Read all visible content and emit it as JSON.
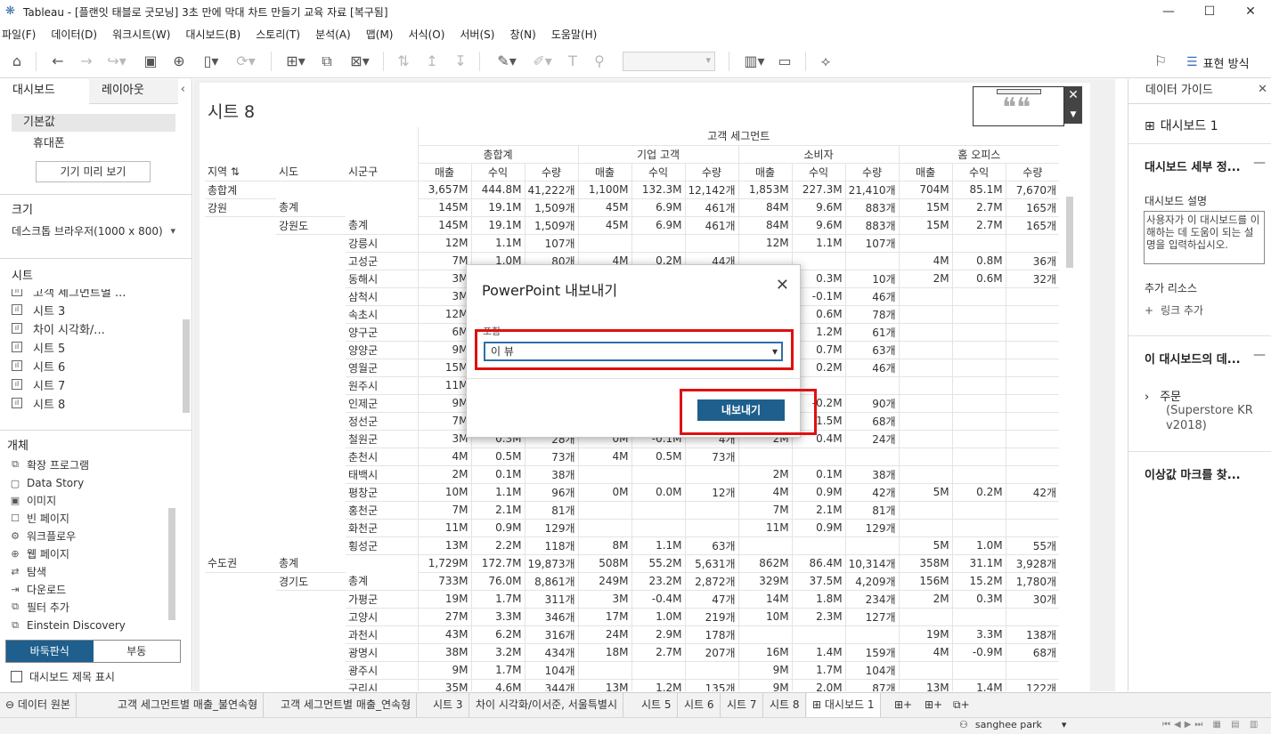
{
  "window": {
    "title": "Tableau - [플랜잇 태블로 굿모닝] 3초 만에 막대 차트 만들기 교육 자료 [복구됨]",
    "minimize": "—",
    "maximize": "☐",
    "close": "✕"
  },
  "menu": [
    "파일(F)",
    "데이터(D)",
    "워크시트(W)",
    "대시보드(B)",
    "스토리(T)",
    "분석(A)",
    "맵(M)",
    "서식(O)",
    "서버(S)",
    "창(N)",
    "도움말(H)"
  ],
  "toolbar": {
    "present_label": "표현 방식"
  },
  "left": {
    "tab_dashboard": "대시보드",
    "tab_layout": "레이아웃",
    "device_default": "기본값",
    "device_phone": "휴대폰",
    "preview_button": "기기 미리 보기",
    "size_header": "크기",
    "size_value": "데스크톱 브라우저(1000 x 800)",
    "sheets_header": "시트",
    "sheets": [
      "고객 세그먼트별 ...",
      "시트 3",
      "차이 시각화/...",
      "시트 5",
      "시트 6",
      "시트 7",
      "시트 8"
    ],
    "objects_header": "개체",
    "objects": [
      {
        "icon": "extension-icon",
        "glyph": "⧉",
        "label": "확장 프로그램"
      },
      {
        "icon": "data-story-icon",
        "glyph": "▢",
        "label": "Data Story"
      },
      {
        "icon": "image-icon",
        "glyph": "▣",
        "label": "이미지"
      },
      {
        "icon": "blank-page-icon",
        "glyph": "☐",
        "label": "빈 페이지"
      },
      {
        "icon": "workflow-icon",
        "glyph": "⚙",
        "label": "워크플로우"
      },
      {
        "icon": "web-page-icon",
        "glyph": "⊕",
        "label": "웹 페이지"
      },
      {
        "icon": "navigation-icon",
        "glyph": "⇄",
        "label": "탐색"
      },
      {
        "icon": "download-icon",
        "glyph": "⇥",
        "label": "다운로드"
      },
      {
        "icon": "filter-add-icon",
        "glyph": "⧉",
        "label": "필터 추가"
      },
      {
        "icon": "einstein-icon",
        "glyph": "⧉",
        "label": "Einstein Discovery"
      }
    ],
    "tiled": "바둑판식",
    "floating": "부동",
    "show_title": "대시보드 제목 표시"
  },
  "dashboard": {
    "sheet_title": "시트 8",
    "segment_header": "고객 세그먼트",
    "segments": [
      "총합계",
      "기업 고객",
      "소비자",
      "홈 오피스"
    ],
    "measures": [
      "매출",
      "수익",
      "수량"
    ],
    "dim_headers": [
      "지역",
      "시도",
      "시군구"
    ],
    "rows": [
      [
        "총합계",
        "",
        "",
        "3,657M",
        "444.8M",
        "41,222개",
        "1,100M",
        "132.3M",
        "12,142개",
        "1,853M",
        "227.3M",
        "21,410개",
        "704M",
        "85.1M",
        "7,670개"
      ],
      [
        "강원",
        "총계",
        "",
        "145M",
        "19.1M",
        "1,509개",
        "45M",
        "6.9M",
        "461개",
        "84M",
        "9.6M",
        "883개",
        "15M",
        "2.7M",
        "165개"
      ],
      [
        "",
        "강원도",
        "총계",
        "145M",
        "19.1M",
        "1,509개",
        "45M",
        "6.9M",
        "461개",
        "84M",
        "9.6M",
        "883개",
        "15M",
        "2.7M",
        "165개"
      ],
      [
        "",
        "",
        "강릉시",
        "12M",
        "1.1M",
        "107개",
        "",
        "",
        "",
        "12M",
        "1.1M",
        "107개",
        "",
        "",
        ""
      ],
      [
        "",
        "",
        "고성군",
        "7M",
        "1.0M",
        "80개",
        "4M",
        "0.2M",
        "44개",
        "",
        "",
        "",
        "4M",
        "0.8M",
        "36개"
      ],
      [
        "",
        "",
        "동해시",
        "3M",
        "",
        "",
        "",
        "",
        "",
        "",
        "0.3M",
        "10개",
        "2M",
        "0.6M",
        "32개"
      ],
      [
        "",
        "",
        "삼척시",
        "3M",
        "",
        "",
        "",
        "",
        "",
        "",
        "-0.1M",
        "46개",
        "",
        "",
        ""
      ],
      [
        "",
        "",
        "속초시",
        "12M",
        "",
        "",
        "",
        "",
        "",
        "",
        "0.6M",
        "78개",
        "",
        "",
        ""
      ],
      [
        "",
        "",
        "양구군",
        "6M",
        "",
        "",
        "",
        "",
        "",
        "",
        "1.2M",
        "61개",
        "",
        "",
        ""
      ],
      [
        "",
        "",
        "양양군",
        "9M",
        "",
        "",
        "",
        "",
        "",
        "",
        "0.7M",
        "63개",
        "",
        "",
        ""
      ],
      [
        "",
        "",
        "영월군",
        "15M",
        "",
        "",
        "",
        "",
        "",
        "",
        "0.2M",
        "46개",
        "",
        "",
        ""
      ],
      [
        "",
        "",
        "원주시",
        "11M",
        "",
        "",
        "",
        "",
        "",
        "",
        "",
        "",
        "",
        "",
        ""
      ],
      [
        "",
        "",
        "인제군",
        "9M",
        "",
        "",
        "",
        "",
        "",
        "",
        "-0.2M",
        "90개",
        "",
        "",
        ""
      ],
      [
        "",
        "",
        "정선군",
        "7M",
        "",
        "",
        "",
        "",
        "",
        "",
        "1.5M",
        "68개",
        "",
        "",
        ""
      ],
      [
        "",
        "",
        "철원군",
        "3M",
        "0.3M",
        "28개",
        "0M",
        "-0.1M",
        "4개",
        "2M",
        "0.4M",
        "24개",
        "",
        "",
        ""
      ],
      [
        "",
        "",
        "춘천시",
        "4M",
        "0.5M",
        "73개",
        "4M",
        "0.5M",
        "73개",
        "",
        "",
        "",
        "",
        "",
        ""
      ],
      [
        "",
        "",
        "태백시",
        "2M",
        "0.1M",
        "38개",
        "",
        "",
        "",
        "2M",
        "0.1M",
        "38개",
        "",
        "",
        ""
      ],
      [
        "",
        "",
        "평창군",
        "10M",
        "1.1M",
        "96개",
        "0M",
        "0.0M",
        "12개",
        "4M",
        "0.9M",
        "42개",
        "5M",
        "0.2M",
        "42개"
      ],
      [
        "",
        "",
        "홍천군",
        "7M",
        "2.1M",
        "81개",
        "",
        "",
        "",
        "7M",
        "2.1M",
        "81개",
        "",
        "",
        ""
      ],
      [
        "",
        "",
        "화천군",
        "11M",
        "0.9M",
        "129개",
        "",
        "",
        "",
        "11M",
        "0.9M",
        "129개",
        "",
        "",
        ""
      ],
      [
        "",
        "",
        "횡성군",
        "13M",
        "2.2M",
        "118개",
        "8M",
        "1.1M",
        "63개",
        "",
        "",
        "",
        "5M",
        "1.0M",
        "55개"
      ],
      [
        "수도권",
        "총계",
        "",
        "1,729M",
        "172.7M",
        "19,873개",
        "508M",
        "55.2M",
        "5,631개",
        "862M",
        "86.4M",
        "10,314개",
        "358M",
        "31.1M",
        "3,928개"
      ],
      [
        "",
        "경기도",
        "총계",
        "733M",
        "76.0M",
        "8,861개",
        "249M",
        "23.2M",
        "2,872개",
        "329M",
        "37.5M",
        "4,209개",
        "156M",
        "15.2M",
        "1,780개"
      ],
      [
        "",
        "",
        "가평군",
        "19M",
        "1.7M",
        "311개",
        "3M",
        "-0.4M",
        "47개",
        "14M",
        "1.8M",
        "234개",
        "2M",
        "0.3M",
        "30개"
      ],
      [
        "",
        "",
        "고양시",
        "27M",
        "3.3M",
        "346개",
        "17M",
        "1.0M",
        "219개",
        "10M",
        "2.3M",
        "127개",
        "",
        "",
        ""
      ],
      [
        "",
        "",
        "과천시",
        "43M",
        "6.2M",
        "316개",
        "24M",
        "2.9M",
        "178개",
        "",
        "",
        "",
        "19M",
        "3.3M",
        "138개"
      ],
      [
        "",
        "",
        "광명시",
        "38M",
        "3.2M",
        "434개",
        "18M",
        "2.7M",
        "207개",
        "16M",
        "1.4M",
        "159개",
        "4M",
        "-0.9M",
        "68개"
      ],
      [
        "",
        "",
        "광주시",
        "9M",
        "1.7M",
        "104개",
        "",
        "",
        "",
        "9M",
        "1.7M",
        "104개",
        "",
        "",
        ""
      ],
      [
        "",
        "",
        "구리시",
        "35M",
        "4.6M",
        "344개",
        "13M",
        "1.2M",
        "135개",
        "9M",
        "2.0M",
        "87개",
        "13M",
        "1.4M",
        "122개"
      ]
    ]
  },
  "right": {
    "header": "데이터 가이드",
    "dashboard_name": "대시보드 1",
    "details_header": "대시보드 세부 정...",
    "desc_label": "대시보드 설명",
    "desc_placeholder": "사용자가 이 대시보드를 이해하는 데 도움이 되는 설명을 입력하십시오.",
    "resources_label": "추가 리소스",
    "add_link": "링크 추가",
    "data_header": "이 대시보드의 데...",
    "datasource": "주문",
    "datasource_sub": "(Superstore KR v2018)",
    "outlier_header": "이상값 마크를 찾..."
  },
  "dialog": {
    "title": "PowerPoint 내보내기",
    "field_label": "포함",
    "select_value": "이 뷰",
    "export_button": "내보내기"
  },
  "bottom_tabs": [
    "데이터 원본",
    "고객 세그먼트별 매출_불연속형",
    "고객 세그먼트별 매출_연속형",
    "시트 3",
    "차이 시각화/이서준, 서울특별시",
    "시트 5",
    "시트 6",
    "시트 7",
    "시트 8",
    "대시보드 1"
  ],
  "status": {
    "user": "sanghee park"
  },
  "colors": {
    "accent": "#1e5f8d",
    "highlight": "#e01010"
  }
}
